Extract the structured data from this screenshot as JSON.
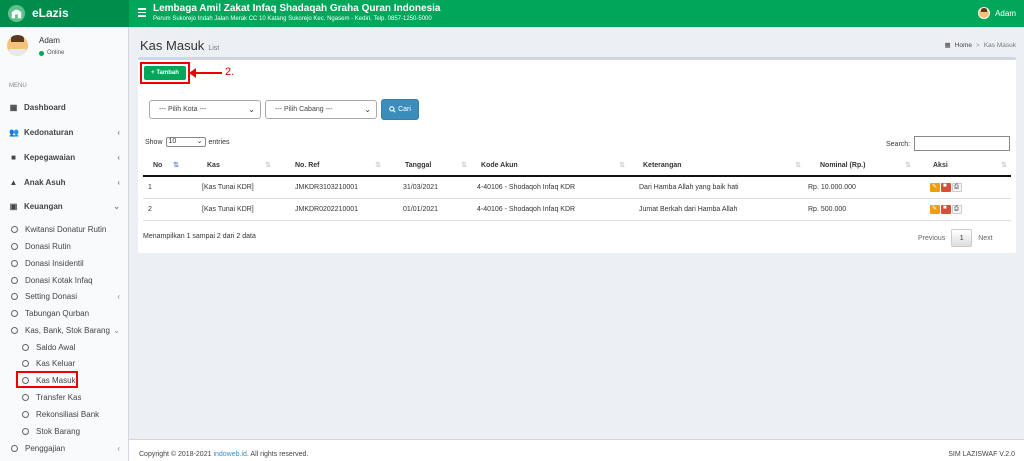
{
  "app": {
    "logo": "eLazis"
  },
  "header": {
    "org_name": "Lembaga Amil Zakat Infaq Shadaqah Graha Quran Indonesia",
    "org_address": "Perum Sukorejo Indah Jalan Merak CC 10 Katang Sukorejo Kec. Ngasem - Kediri, Telp. 0857-1250-5000",
    "user": "Adam"
  },
  "sidebar": {
    "user_name": "Adam",
    "user_status": "Online",
    "menu_header": "MENU",
    "items": [
      {
        "label": "Dashboard",
        "icon": "th-icon"
      },
      {
        "label": "Kedonaturan",
        "icon": "users-icon"
      },
      {
        "label": "Kepegawaian",
        "icon": "briefcase-icon"
      },
      {
        "label": "Anak Asuh",
        "icon": "graduation-cap-icon"
      },
      {
        "label": "Keuangan",
        "icon": "money-icon"
      }
    ],
    "keuangan_sub": [
      "Kwitansi Donatur Rutin",
      "Donasi Rutin",
      "Donasi Insidentil",
      "Donasi Kotak Infaq",
      "Setting Donasi",
      "Tabungan Qurban",
      "Kas, Bank, Stok Barang"
    ],
    "kas_sub": [
      "Saldo Awal",
      "Kas Keluar",
      "Kas Masuk",
      "Transfer Kas",
      "Rekonsiliasi Bank",
      "Stok Barang"
    ],
    "penggajian": "Penggajian"
  },
  "page": {
    "title": "Kas Masuk",
    "subtitle": "List",
    "breadcrumb_home": "Home",
    "breadcrumb_current": "Kas Masuk"
  },
  "toolbar": {
    "add_label": "Tambah",
    "step_label": "2.",
    "kota_placeholder": "--- Pilih Kota ---",
    "cabang_placeholder": "--- Pilih Cabang ---",
    "cari_label": "Cari"
  },
  "table": {
    "show_label": "Show",
    "entries_value": "10",
    "entries_label": "entries",
    "search_label": "Search:",
    "columns": [
      "No",
      "Kas",
      "No. Ref",
      "Tanggal",
      "Kode Akun",
      "Keterangan",
      "Nominal (Rp.)",
      "Aksi"
    ],
    "rows": [
      [
        "1",
        "[Kas Tunai KDR]",
        "JMKDR3103210001",
        "31/03/2021",
        "4-40106 - Shodaqoh Infaq KDR",
        "Dari Hamba Allah yang baik hati",
        "Rp. 10.000.000"
      ],
      [
        "2",
        "[Kas Tunai KDR]",
        "JMKDR0202210001",
        "01/01/2021",
        "4-40106 - Shodaqoh Infaq KDR",
        "Jumat Berkah dari Hamba Allah",
        "Rp. 500.000"
      ]
    ],
    "info": "Menampilkan 1 sampai 2 dari 2 data",
    "prev": "Previous",
    "page": "1",
    "next": "Next"
  },
  "footer": {
    "copyright_prefix": "Copyright © 2018-2021",
    "link": "indoweb.id",
    "suffix": ". All rights reserved.",
    "version": "SIM LAZISWAF V.2.0"
  }
}
